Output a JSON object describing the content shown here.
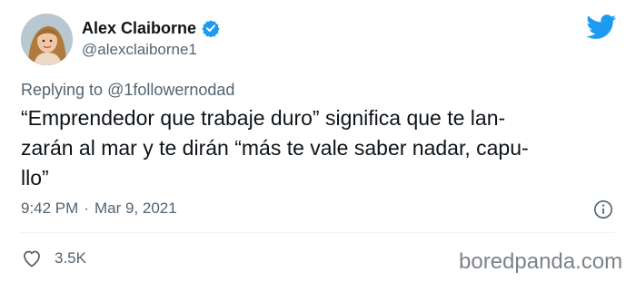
{
  "author": {
    "display_name": "Alex Claiborne",
    "handle": "@alexclaiborne1",
    "verified": true
  },
  "reply": {
    "prefix": "Replying to",
    "to": "@1followernodad"
  },
  "tweet": {
    "lines": [
      "“Emprendedor que trabaje duro” significa que te  lan-",
      "zarán al mar y te dirán “más te vale saber nadar, capu-",
      "llo”"
    ]
  },
  "meta": {
    "time": "9:42 PM",
    "separator": "·",
    "date": "Mar 9, 2021"
  },
  "stats": {
    "likes": "3.5K"
  },
  "watermark": "boredpanda.com",
  "colors": {
    "accent": "#1d9bf0",
    "secondary_text": "#536471",
    "primary_text": "#0f1419"
  },
  "icons": [
    "verified-badge-icon",
    "twitter-bird-icon",
    "info-icon",
    "heart-icon"
  ]
}
